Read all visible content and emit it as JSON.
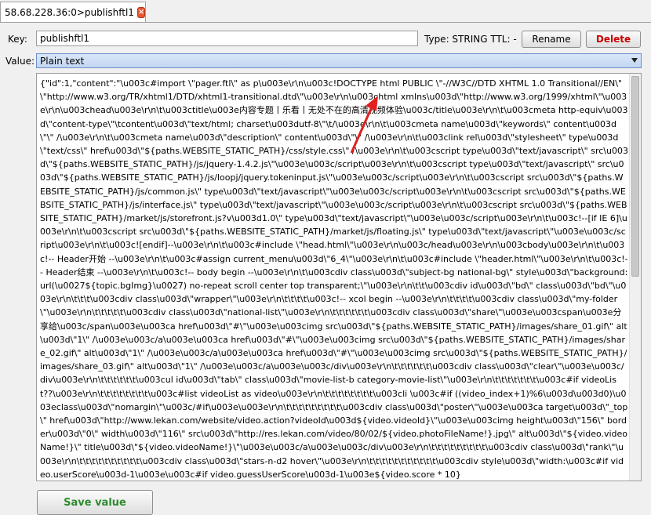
{
  "tab": {
    "title": "58.68.228.36:0>publishftl1",
    "close_glyph": "×"
  },
  "key": {
    "label": "Key:",
    "value": "publishftl1"
  },
  "meta": {
    "text": "Type: STRING  TTL: -"
  },
  "buttons": {
    "rename": "Rename",
    "delete": "Delete",
    "save": "Save value"
  },
  "value": {
    "label": "Value:",
    "format": "Plain text"
  },
  "content": "{\"id\":1,\"content\":\"\\u003c#import \\\"pager.ftl\\\" as p\\u003e\\r\\n\\u003c!DOCTYPE html PUBLIC \\\"-//W3C//DTD XHTML 1.0 Transitional//EN\\\" \\\"http://www.w3.org/TR/xhtml1/DTD/xhtml1-transitional.dtd\\\"\\u003e\\r\\n\\u003chtml xmlns\\u003d\\\"http://www.w3.org/1999/xhtml\\\"\\u003e\\r\\n\\u003chead\\u003e\\r\\n\\t\\u003ctitle\\u003e内容专题丨乐看丨无处不在的高清视频体验\\u003c/title\\u003e\\r\\n\\t\\u003cmeta http-equiv\\u003d\\\"content-type\\\"\\tcontent\\u003d\\\"text/html; charset\\u003dutf-8\\\"\\t/\\u003e\\r\\n\\t\\u003cmeta name\\u003d\\\"keywords\\\" content\\u003d\\\"\\\" /\\u003e\\r\\n\\t\\u003cmeta name\\u003d\\\"description\\\" content\\u003d\\\"\\\" /\\u003e\\r\\n\\t\\u003clink rel\\u003d\\\"stylesheet\\\" type\\u003d\\\"text/css\\\" href\\u003d\\\"${paths.WEBSITE_STATIC_PATH}/css/style.css\\\" /\\u003e\\r\\n\\t\\u003cscript type\\u003d\\\"text/javascript\\\" src\\u003d\\\"${paths.WEBSITE_STATIC_PATH}/js/jquery-1.4.2.js\\\"\\u003e\\u003c/script\\u003e\\r\\n\\t\\u003cscript type\\u003d\\\"text/javascript\\\" src\\u003d\\\"${paths.WEBSITE_STATIC_PATH}/js/loopj/jquery.tokeninput.js\\\"\\u003e\\u003c/script\\u003e\\r\\n\\t\\u003cscript src\\u003d\\\"${paths.WEBSITE_STATIC_PATH}/js/common.js\\\" type\\u003d\\\"text/javascript\\\"\\u003e\\u003c/script\\u003e\\r\\n\\t\\u003cscript src\\u003d\\\"${paths.WEBSITE_STATIC_PATH}/js/interface.js\\\" type\\u003d\\\"text/javascript\\\"\\u003e\\u003c/script\\u003e\\r\\n\\t\\u003cscript src\\u003d\\\"${paths.WEBSITE_STATIC_PATH}/market/js/storefront.js?v\\u003d1.0\\\" type\\u003d\\\"text/javascript\\\"\\u003e\\u003c/script\\u003e\\r\\n\\t\\u003c!--[if IE 6]\\u003e\\r\\n\\t\\u003cscript src\\u003d\\\"${paths.WEBSITE_STATIC_PATH}/market/js/floating.js\\\" type\\u003d\\\"text/javascript\\\"\\u003e\\u003c/script\\u003e\\r\\n\\t\\u003c![endif]--\\u003e\\r\\n\\t\\u003c#include \\\"head.html\\\"\\u003e\\r\\n\\u003c/head\\u003e\\r\\n\\u003cbody\\u003e\\r\\n\\t\\u003c!-- Header开始 --\\u003e\\r\\n\\t\\u003c#assign current_menu\\u003d\\\"6_4\\\"\\u003e\\r\\n\\t\\u003c#include \\\"header.html\\\"\\u003e\\r\\n\\t\\u003c!-- Header结束 --\\u003e\\r\\n\\t\\u003c!-- body begin --\\u003e\\r\\n\\t\\u003cdiv class\\u003d\\\"subject-bg national-bg\\\" style\\u003d\\\"background:url(\\u0027${topic.bgImg}\\u0027) no-repeat scroll center top transparent;\\\"\\u003e\\r\\n\\t\\t\\u003cdiv id\\u003d\\\"bd\\\" class\\u003d\\\"bd\\\"\\u003e\\r\\n\\t\\t\\t\\u003cdiv class\\u003d\\\"wrapper\\\"\\u003e\\r\\n\\t\\t\\t\\t\\u003c!-- xcol begin --\\u003e\\r\\n\\t\\t\\t\\t\\u003cdiv class\\u003d\\\"my-folder\\\"\\u003e\\r\\n\\t\\t\\t\\t\\t\\u003cdiv class\\u003d\\\"national-list\\\"\\u003e\\r\\n\\t\\t\\t\\t\\t\\t\\u003cdiv class\\u003d\\\"share\\\"\\u003e\\u003cspan\\u003e分享给\\u003c/span\\u003e\\u003ca href\\u003d\\\"#\\\"\\u003e\\u003cimg src\\u003d\\\"${paths.WEBSITE_STATIC_PATH}/images/share_01.gif\\\" alt\\u003d\\\"1\\\" /\\u003e\\u003c/a\\u003e\\u003ca href\\u003d\\\"#\\\"\\u003e\\u003cimg src\\u003d\\\"${paths.WEBSITE_STATIC_PATH}/images/share_02.gif\\\" alt\\u003d\\\"1\\\" /\\u003e\\u003c/a\\u003e\\u003ca href\\u003d\\\"#\\\"\\u003e\\u003cimg src\\u003d\\\"${paths.WEBSITE_STATIC_PATH}/images/share_03.gif\\\" alt\\u003d\\\"1\\\" /\\u003e\\u003c/a\\u003e\\u003c/div\\u003e\\r\\n\\t\\t\\t\\t\\t\\t\\u003cdiv class\\u003d\\\"clear\\\"\\u003e\\u003c/div\\u003e\\r\\n\\t\\t\\t\\t\\t\\t\\u003cul id\\u003d\\\"tab\\\" class\\u003d\\\"movie-list-b category-movie-list\\\"\\u003e\\r\\n\\t\\t\\t\\t\\t\\t\\t\\u003c#if videoList??\\u003e\\r\\n\\t\\t\\t\\t\\t\\t\\t\\t\\u003c#list videoList as video\\u003e\\r\\n\\t\\t\\t\\t\\t\\t\\t\\t\\u003cli \\u003c#if ((video_index+1)%6\\u003d\\u003d0)\\u003eclass\\u003d\\\"nomargin\\\"\\u003c/#if\\u003e\\u003e\\r\\n\\t\\t\\t\\t\\t\\t\\t\\t\\t\\u003cdiv class\\u003d\\\"poster\\\"\\u003e\\u003ca target\\u003d\\\"_top\\\" href\\u003d\\\"http://www.lekan.com/website/video.action?videoId\\u003d${video.videoId}\\\"\\u003e\\u003cimg height\\u003d\\\"156\\\" border\\u003d\\\"0\\\" width\\u003d\\\"116\\\" src\\u003d\\\"http://res.lekan.com/video/80/02/${video.photoFileName!}.jpg\\\" alt\\u003d\\\"${video.videoName!}\\\" title\\u003d\\\"${video.videoName!}\\\"\\u003e\\u003c/a\\u003e\\u003c/div\\u003e\\r\\n\\t\\t\\t\\t\\t\\t\\t\\t\\t\\u003cdiv class\\u003d\\\"rank\\\"\\u003e\\r\\n\\t\\t\\t\\t\\t\\t\\t\\t\\t\\t\\u003cdiv class\\u003d\\\"stars-n-d2 hover\\\"\\u003e\\r\\n\\t\\t\\t\\t\\t\\t\\t\\t\\t\\t\\t\\u003cdiv style\\u003d\\\"width:\\u003c#if video.userScore\\u003d-1\\u003e\\u003c#if video.guessUserScore\\u003d-1\\u003e${video.score * 10}"
}
